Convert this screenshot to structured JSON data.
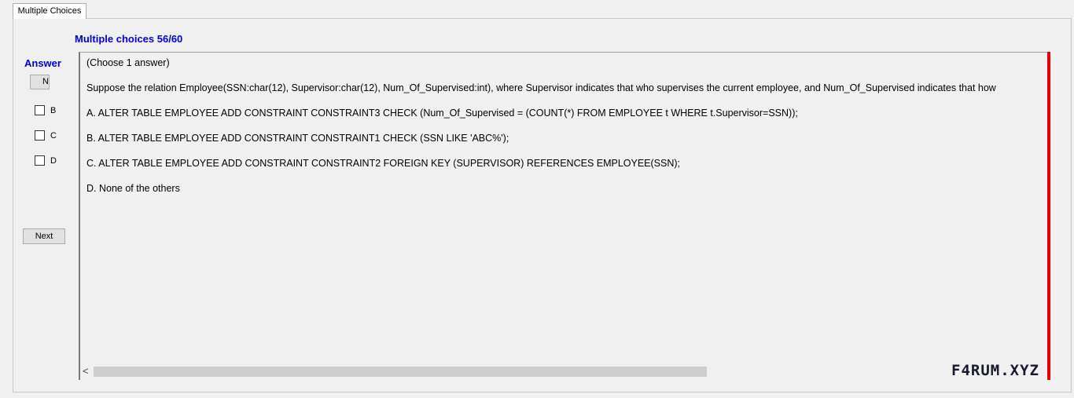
{
  "tab": {
    "label": "Multiple Choices"
  },
  "header": {
    "title": "Multiple choices 56/60"
  },
  "answer_panel": {
    "label": "Answer",
    "small_button_label": "Next",
    "options": [
      {
        "label": "B",
        "checked": false
      },
      {
        "label": "C",
        "checked": false
      },
      {
        "label": "D",
        "checked": false
      }
    ],
    "next_button_label": "Next"
  },
  "question": {
    "instruction": "(Choose 1 answer)",
    "text": "Suppose the relation Employee(SSN:char(12), Supervisor:char(12), Num_Of_Supervised:int), where Supervisor indicates that who supervises the current employee, and Num_Of_Supervised indicates that how",
    "choices": [
      "A.  ALTER TABLE EMPLOYEE ADD CONSTRAINT CONSTRAINT3 CHECK (Num_Of_Supervised = (COUNT(*) FROM EMPLOYEE t WHERE t.Supervisor=SSN));",
      "B.  ALTER TABLE EMPLOYEE ADD CONSTRAINT CONSTRAINT1 CHECK (SSN LIKE 'ABC%');",
      "C.  ALTER TABLE EMPLOYEE ADD CONSTRAINT CONSTRAINT2 FOREIGN KEY (SUPERVISOR) REFERENCES EMPLOYEE(SSN);",
      "D.  None of the others"
    ]
  },
  "scrollbar": {
    "left_arrow": "<"
  },
  "watermark": {
    "text": "F4RUM.XYZ"
  },
  "colors": {
    "title": "#0000cc",
    "side_bar": "#e60000"
  }
}
